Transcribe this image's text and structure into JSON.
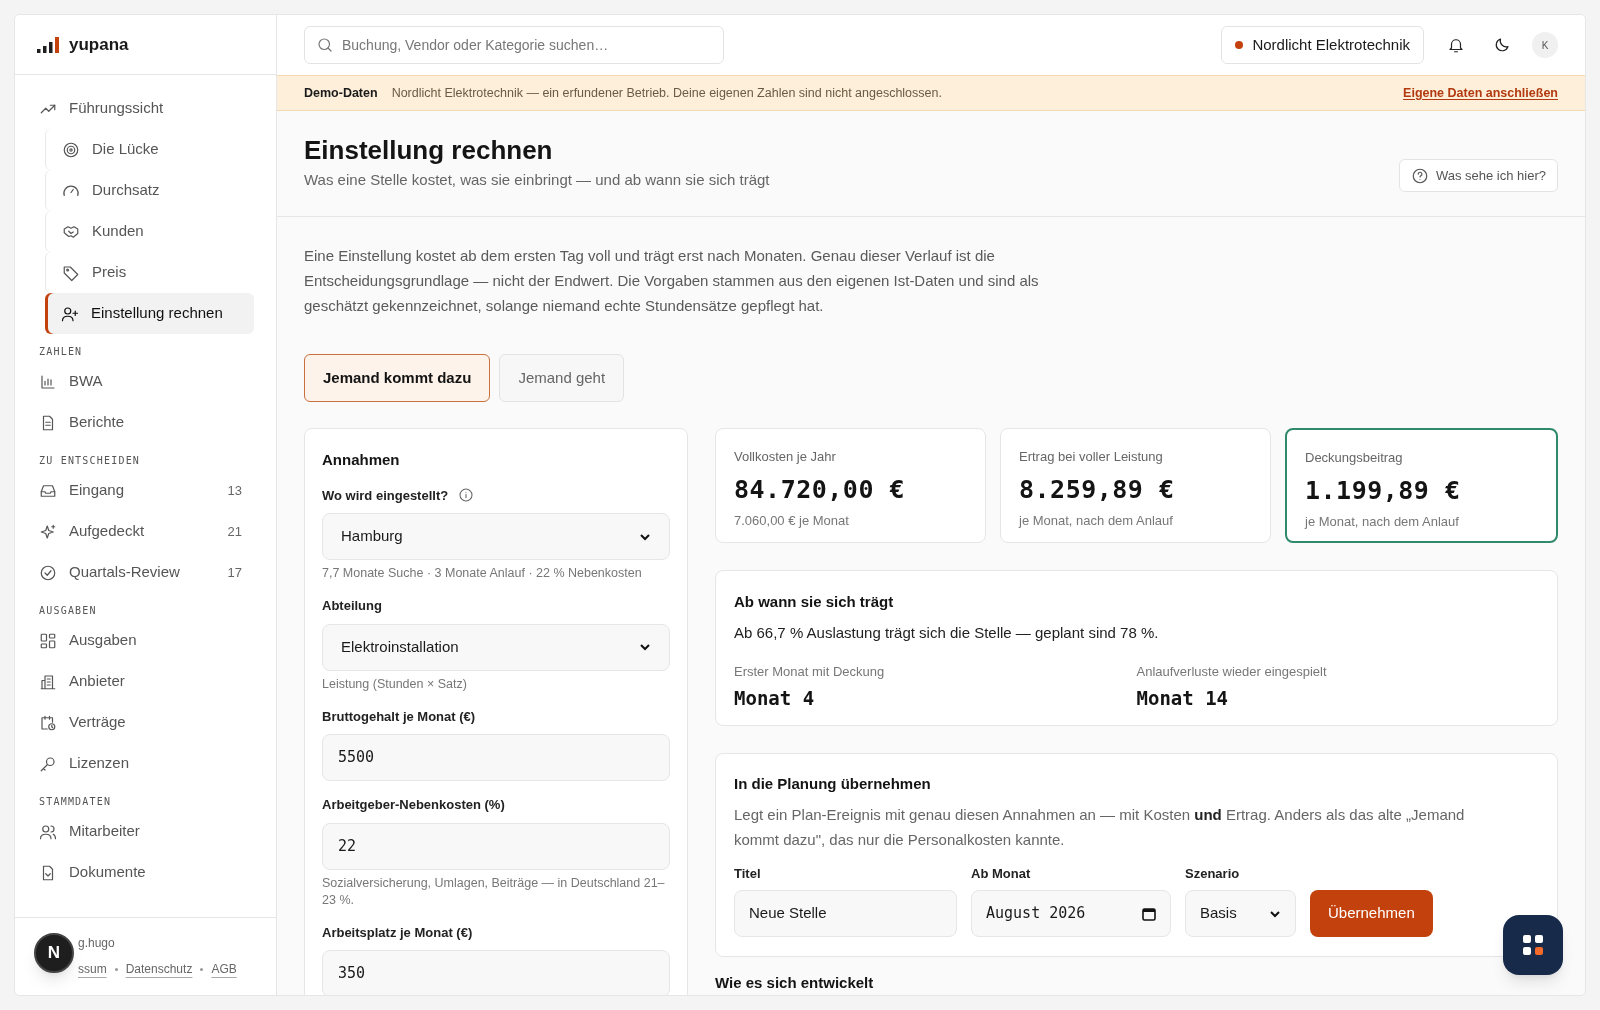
{
  "brand": {
    "name": "yupana"
  },
  "sidebar": {
    "top": {
      "label": "Führungssicht",
      "selected": false,
      "children": [
        {
          "label": "Die Lücke",
          "selected": false
        },
        {
          "label": "Durchsatz",
          "selected": false
        },
        {
          "label": "Kunden",
          "selected": false
        },
        {
          "label": "Preis",
          "selected": false
        },
        {
          "label": "Einstellung rechnen",
          "selected": true
        }
      ]
    },
    "sections": [
      {
        "title": "ZAHLEN",
        "items": [
          {
            "label": "BWA",
            "selected": false
          },
          {
            "label": "Berichte",
            "selected": false
          }
        ]
      },
      {
        "title": "ZU ENTSCHEIDEN",
        "items": [
          {
            "label": "Eingang",
            "count": "13",
            "selected": false
          },
          {
            "label": "Aufgedeckt",
            "count": "21",
            "selected": false
          },
          {
            "label": "Quartals-Review",
            "count": "17",
            "selected": false
          }
        ]
      },
      {
        "title": "AUSGABEN",
        "items": [
          {
            "label": "Ausgaben",
            "selected": false
          },
          {
            "label": "Anbieter",
            "selected": false
          },
          {
            "label": "Verträge",
            "selected": false
          },
          {
            "label": "Lizenzen",
            "selected": false
          }
        ]
      },
      {
        "title": "STAMMDATEN",
        "items": [
          {
            "label": "Mitarbeiter",
            "selected": false
          },
          {
            "label": "Dokumente",
            "selected": false
          }
        ]
      }
    ],
    "footer": {
      "credit": "g.hugo",
      "links": [
        "ssum",
        "Datenschutz",
        "AGB"
      ]
    }
  },
  "topbar": {
    "search": {
      "placeholder": "Buchung, Vendor oder Kategorie suchen…"
    },
    "company": "Nordlicht Elektrotechnik",
    "avatar": "K"
  },
  "banner": {
    "label": "Demo-Daten",
    "text": "Nordlicht Elektrotechnik — ein erfundener Betrieb. Deine eigenen Zahlen sind nicht angeschlossen.",
    "link": "Eigene Daten anschließen"
  },
  "header": {
    "title": "Einstellung rechnen",
    "subtitle": "Was eine Stelle kostet, was sie einbringt — und ab wann sie sich trägt",
    "help": "Was sehe ich hier?"
  },
  "intro": "Eine Einstellung kostet ab dem ersten Tag voll und trägt erst nach Monaten. Genau dieser Verlauf ist die Entscheidungsgrundlage — nicht der Endwert. Die Vorgaben stammen aus den eigenen Ist-Daten und sind als geschätzt gekennzeichnet, solange niemand echte Stundensätze gepflegt hat.",
  "tabs": [
    {
      "label": "Jemand kommt dazu",
      "selected": true
    },
    {
      "label": "Jemand geht",
      "selected": false
    }
  ],
  "assumptions": {
    "title": "Annahmen",
    "fields": [
      {
        "kind": "select",
        "label": "Wo wird eingestellt?",
        "info": true,
        "value": "Hamburg",
        "hint": "7,7 Monate Suche · 3 Monate Anlauf · 22 % Nebenkosten"
      },
      {
        "kind": "select",
        "label": "Abteilung",
        "value": "Elektroinstallation",
        "hint": "Leistung (Stunden × Satz)"
      },
      {
        "kind": "number",
        "label": "Bruttogehalt je Monat (€)",
        "value": "5500"
      },
      {
        "kind": "number",
        "label": "Arbeitgeber-Nebenkosten (%)",
        "value": "22",
        "hint": "Sozialversicherung, Umlagen, Beiträge — in Deutschland 21–23 %."
      },
      {
        "kind": "number",
        "label": "Arbeitsplatz je Monat (€)",
        "value": "350"
      }
    ]
  },
  "kpis": [
    {
      "label": "Vollkosten je Jahr",
      "value": "84.720,00 €",
      "note": "7.060,00 € je Monat",
      "highlighted": false
    },
    {
      "label": "Ertrag bei voller Leistung",
      "value": "8.259,89 €",
      "note": "je Monat, nach dem Anlauf",
      "highlighted": false
    },
    {
      "label": "Deckungsbeitrag",
      "value": "1.199,89 €",
      "note": "je Monat, nach dem Anlauf",
      "highlighted": true
    }
  ],
  "breakeven": {
    "title": "Ab wann sie sich trägt",
    "text": "Ab 66,7 % Auslastung trägt sich die Stelle — geplant sind 78 %.",
    "metrics": [
      {
        "label": "Erster Monat mit Deckung",
        "value": "Monat 4"
      },
      {
        "label": "Anlaufverluste wieder eingespielt",
        "value": "Monat 14"
      }
    ]
  },
  "planning": {
    "title": "In die Planung übernehmen",
    "text": "Legt ein Plan-Ereignis mit genau diesen Annahmen an — mit Kosten **und** Ertrag. Anders als das alte „Jemand kommt dazu\", das nur die Personalkosten kannte.",
    "fields": [
      {
        "kind": "text",
        "label": "Titel",
        "value": "Neue Stelle"
      },
      {
        "kind": "month",
        "label": "Ab Monat",
        "value": "August 2026"
      },
      {
        "kind": "select",
        "label": "Szenario",
        "value": "Basis"
      }
    ],
    "button": "Übernehmen"
  },
  "next_section": {
    "title": "Wie es sich entwickelt"
  },
  "dev_indicator": "N"
}
